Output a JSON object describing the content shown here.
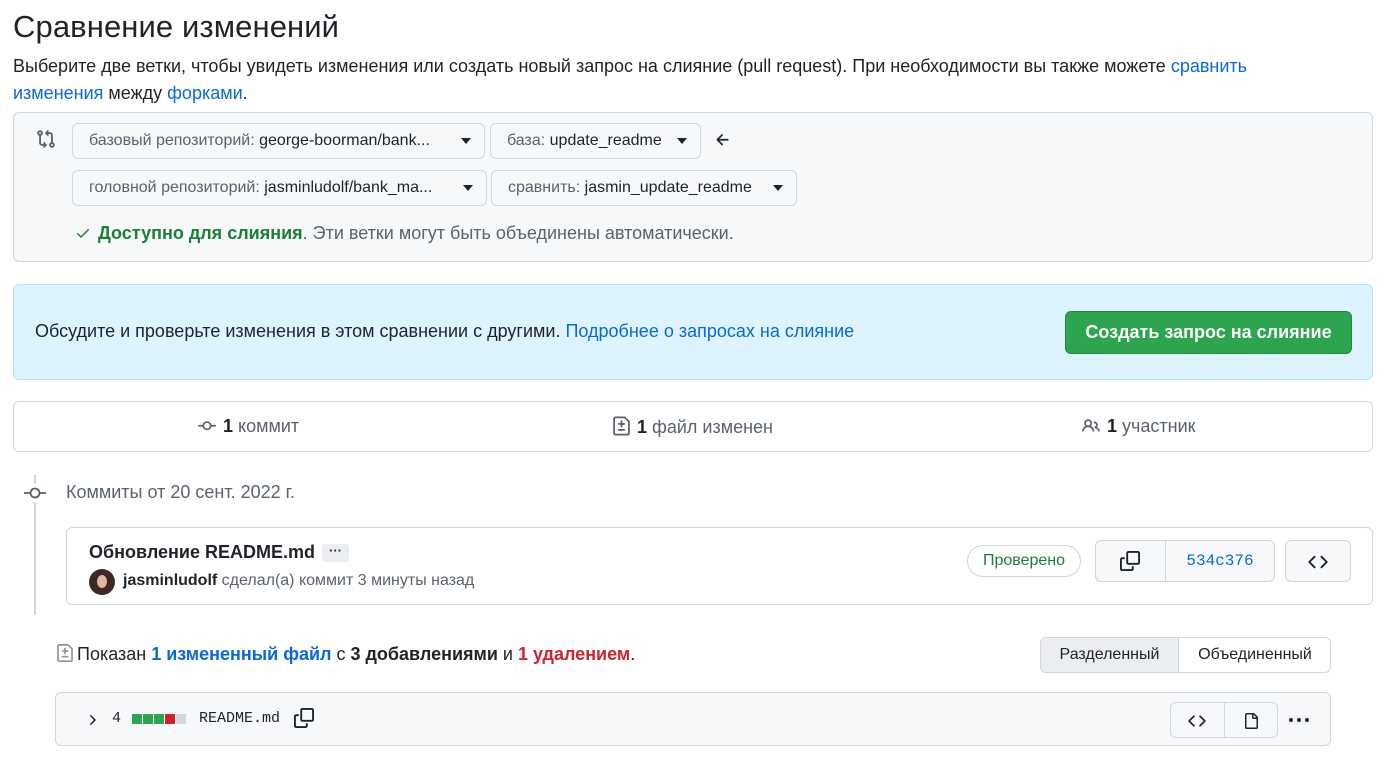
{
  "header": {
    "title": "Сравнение изменений",
    "subtitle_text": "Выберите две ветки, чтобы увидеть изменения или создать новый запрос на слияние (pull request). При необходимости вы также можете ",
    "subtitle_link_compare": "сравнить изменения",
    "subtitle_between": " между ",
    "subtitle_link_forks": "форками",
    "subtitle_end": "."
  },
  "range": {
    "base_repo_label": "базовый репозиторий:",
    "base_repo_value": "george-boorman/bank...",
    "base_label": "база:",
    "base_value": "update_readme",
    "head_repo_label": "головной репозиторий:",
    "head_repo_value": "jasminludolf/bank_ma...",
    "compare_label": "сравнить:",
    "compare_value": "jasmin_update_readme",
    "merge_ok": "Доступно для слияния",
    "merge_rest": ". Эти ветки могут быть объединены автоматически."
  },
  "flash": {
    "text": "Обсудите и проверьте изменения в этом сравнении с другими. ",
    "link": "Подробнее о запросах на слияние",
    "button": "Создать запрос на слияние"
  },
  "summary": {
    "commits_count": "1",
    "commits_label": " коммит",
    "files_count": "1",
    "files_label": " файл изменен",
    "contributors_count": "1",
    "contributors_label": " участник"
  },
  "commits": {
    "date_heading": "Коммиты от 20 сент. 2022 г.",
    "message": "Обновление README.md",
    "ellipsis": "···",
    "author": "jasminludolf",
    "meta": " сделал(а) коммит 3 минуты назад",
    "verified": "Проверено",
    "sha": "534c376"
  },
  "files": {
    "shown_prefix": "Показан ",
    "shown_link": "1 измененный файл",
    "with": " с ",
    "additions": "3 добавлениями",
    "and": " и ",
    "deletions": "1 удалением",
    "end": ".",
    "view_split": "Разделенный",
    "view_unified": "Объединенный",
    "file_changes": "4",
    "file_name": "README.md",
    "diffstat": [
      "green",
      "green",
      "green",
      "red",
      "gray"
    ]
  },
  "colors": {
    "addition": "#2da44e",
    "deletion": "#cf222e",
    "neutral": "#d0d7de",
    "link": "#0969da",
    "primary_button": "#2da44e"
  }
}
